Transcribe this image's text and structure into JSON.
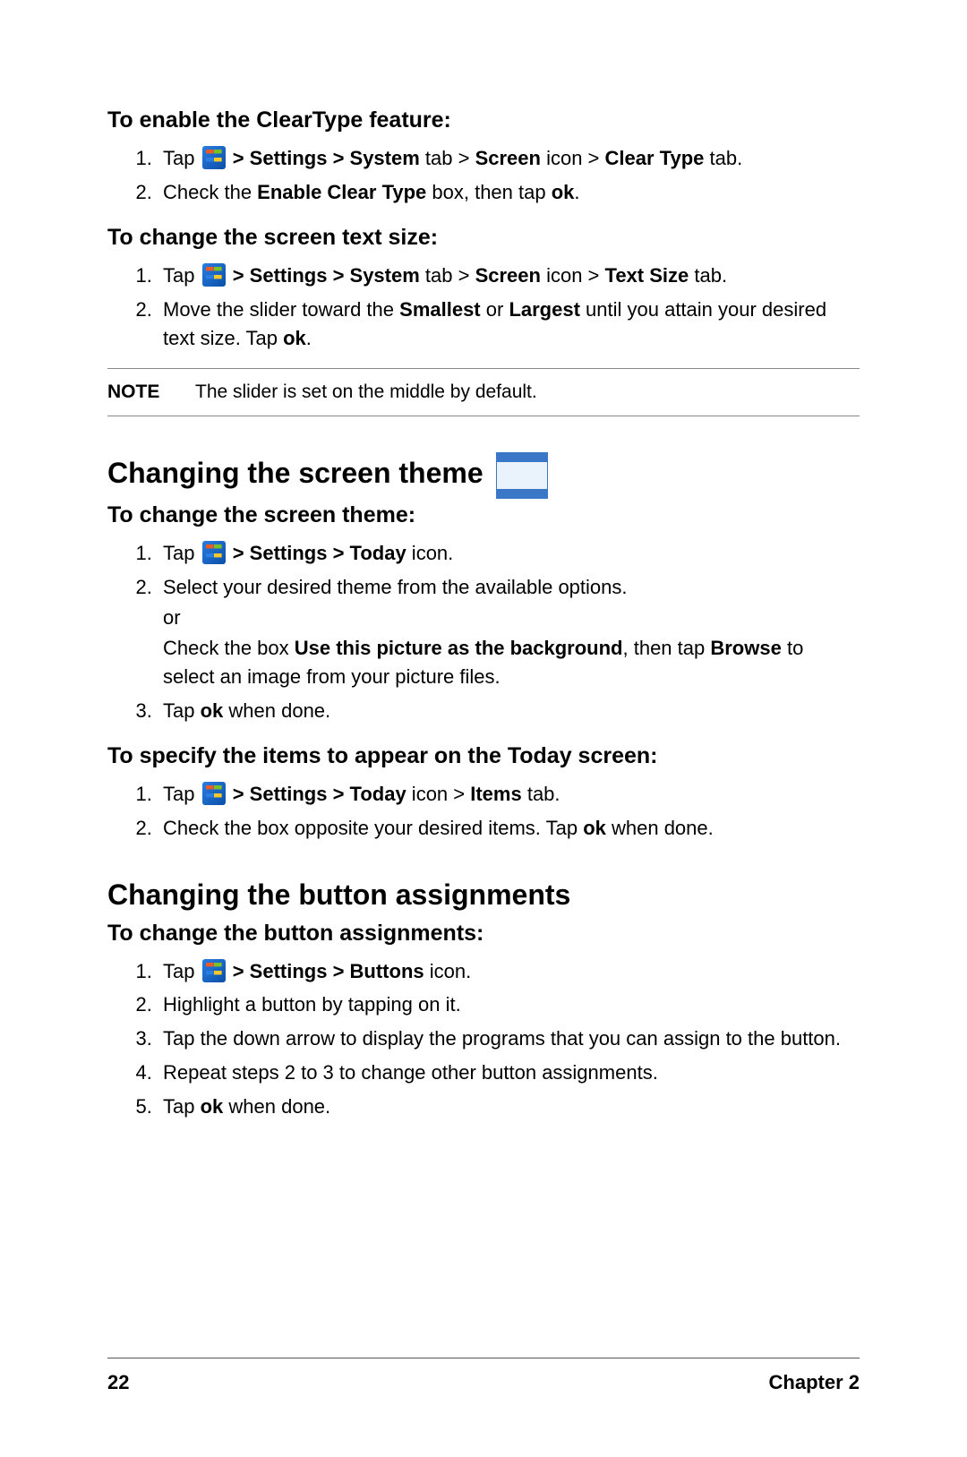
{
  "sec1": {
    "title": "To enable the ClearType feature:",
    "s1a": "Tap ",
    "s1b": " > Settings > System",
    "s1c": " tab > ",
    "s1d": "Screen",
    "s1e": " icon > ",
    "s1f": "Clear Type",
    "s1g": " tab.",
    "s2a": "Check the ",
    "s2b": "Enable Clear Type",
    "s2c": " box, then tap ",
    "s2d": "ok",
    "s2e": "."
  },
  "sec2": {
    "title": "To change the screen text size:",
    "s1a": "Tap ",
    "s1b": " > Settings >  System",
    "s1c": " tab > ",
    "s1d": "Screen",
    "s1e": " icon > ",
    "s1f": "Text Size",
    "s1g": " tab.",
    "s2a": "Move the slider toward the ",
    "s2b": "Smallest",
    "s2c": " or ",
    "s2d": "Largest",
    "s2e": " until you attain your desired text size. Tap ",
    "s2f": "ok",
    "s2g": "."
  },
  "note": {
    "label": "NOTE",
    "text": "The slider is set on the middle by default."
  },
  "sec3": {
    "heading": "Changing the screen theme",
    "title": "To change the screen theme:",
    "s1a": "Tap ",
    "s1b": " > Settings > Today",
    "s1c": " icon.",
    "s2a": "Select your desired theme from the available options.",
    "s2or": "or",
    "s2b1": "Check the box ",
    "s2b2": "Use this picture as the background",
    "s2b3": ", then tap ",
    "s2b4": "Browse",
    "s2b5": " to select an image from your picture files.",
    "s3a": "Tap ",
    "s3b": "ok",
    "s3c": " when done."
  },
  "sec4": {
    "title": "To specify the items to appear on the Today screen:",
    "s1a": "Tap ",
    "s1b": " > Settings >  Today",
    "s1c": " icon > ",
    "s1d": "Items",
    "s1e": " tab.",
    "s2a": "Check the box opposite your desired items. Tap ",
    "s2b": "ok",
    "s2c": " when done."
  },
  "sec5": {
    "heading": "Changing the button assignments",
    "title": "To change the button assignments:",
    "s1a": "Tap ",
    "s1b": " > Settings > Buttons",
    "s1c": " icon.",
    "s2": "Highlight a button by tapping on it.",
    "s3": "Tap the down arrow to display the programs that you can assign to the button.",
    "s4": "Repeat steps 2 to 3 to change other button assignments.",
    "s5a": "Tap ",
    "s5b": "ok",
    "s5c": " when done."
  },
  "footer": {
    "page": "22",
    "chapter": "Chapter 2"
  }
}
